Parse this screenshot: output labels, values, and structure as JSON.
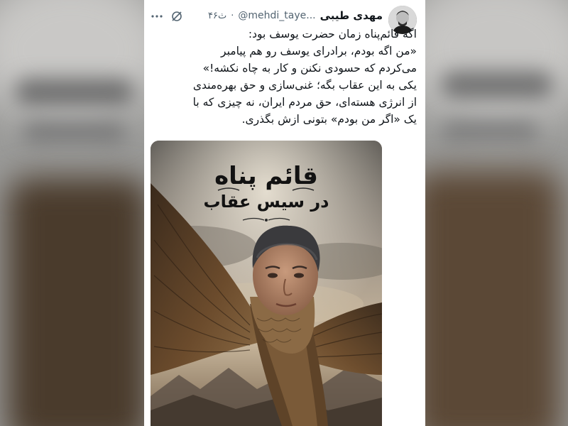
{
  "tweet": {
    "display_name": "مهدی طیبی",
    "handle": "@mehdi_taye...",
    "separator": "·",
    "time": "۴۶ث",
    "text_lines": [
      "اگه قائم‌پناه زمان حضرت یوسف بود:",
      "«من اگه بودم، برادرای یوسف رو هم پیامبر",
      "می‌کردم که حسودی نکنن و کار به چاه نکشه!»",
      "یکی به این عقاب بگه؛ غنی‌سازی و حق بهره‌مندی",
      "از انرژی هسته‌ای، حق مردم ایران، نه چیزی که با",
      "یک «اگر من بودم» بتونی ازش بگذری."
    ],
    "icons": {
      "avatar": "avatar-image",
      "grok": "grok-icon",
      "more": "more-icon"
    }
  },
  "media": {
    "poster_title": "قائم پناه",
    "poster_subtitle": "در سیس عقاب"
  },
  "colors": {
    "text": "#0f1419",
    "muted": "#536471",
    "card_bg": "#ffffff"
  }
}
